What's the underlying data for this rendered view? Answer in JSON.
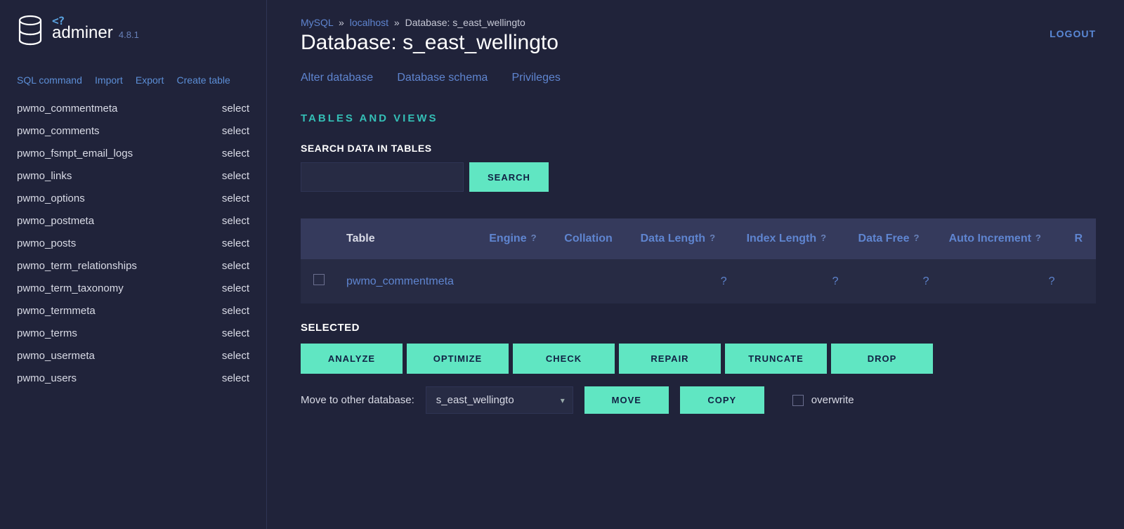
{
  "app": {
    "name": "adminer",
    "version": "4.8.1",
    "php_tag": "<?"
  },
  "logout": "LOGOUT",
  "sidebar": {
    "links": [
      {
        "label": "SQL command"
      },
      {
        "label": "Import"
      },
      {
        "label": "Export"
      },
      {
        "label": "Create table"
      }
    ],
    "select_label": "select",
    "tables": [
      "pwmo_commentmeta",
      "pwmo_comments",
      "pwmo_fsmpt_email_logs",
      "pwmo_links",
      "pwmo_options",
      "pwmo_postmeta",
      "pwmo_posts",
      "pwmo_term_relationships",
      "pwmo_term_taxonomy",
      "pwmo_termmeta",
      "pwmo_terms",
      "pwmo_usermeta",
      "pwmo_users"
    ]
  },
  "breadcrumb": {
    "driver": "MySQL",
    "server": "localhost",
    "db_prefix": "Database:",
    "db": "s_east_wellingto",
    "sep": "»"
  },
  "page": {
    "title": "Database: s_east_wellingto",
    "db_links": [
      {
        "label": "Alter database"
      },
      {
        "label": "Database schema"
      },
      {
        "label": "Privileges"
      }
    ],
    "section_tables": "TABLES AND VIEWS",
    "search_label": "SEARCH DATA IN TABLES",
    "search_button": "Search"
  },
  "table": {
    "columns": [
      {
        "label": "",
        "help": false
      },
      {
        "label": "Table",
        "help": false
      },
      {
        "label": "Engine",
        "help": true
      },
      {
        "label": "Collation",
        "help": false
      },
      {
        "label": "Data Length",
        "help": true
      },
      {
        "label": "Index Length",
        "help": true
      },
      {
        "label": "Data Free",
        "help": true
      },
      {
        "label": "Auto Increment",
        "help": true
      },
      {
        "label": "R",
        "help": false
      }
    ],
    "help_symbol": "?",
    "rows": [
      {
        "name": "pwmo_commentmeta",
        "engine": "",
        "collation": "",
        "data_length": "?",
        "index_length": "?",
        "data_free": "?",
        "auto_increment": "?"
      }
    ]
  },
  "selected": {
    "heading": "SELECTED",
    "actions": [
      "Analyze",
      "Optimize",
      "Check",
      "Repair",
      "Truncate",
      "Drop"
    ],
    "move_label": "Move to other database:",
    "move_db": "s_east_wellingto",
    "move_btn": "Move",
    "copy_btn": "Copy",
    "overwrite": "overwrite"
  }
}
